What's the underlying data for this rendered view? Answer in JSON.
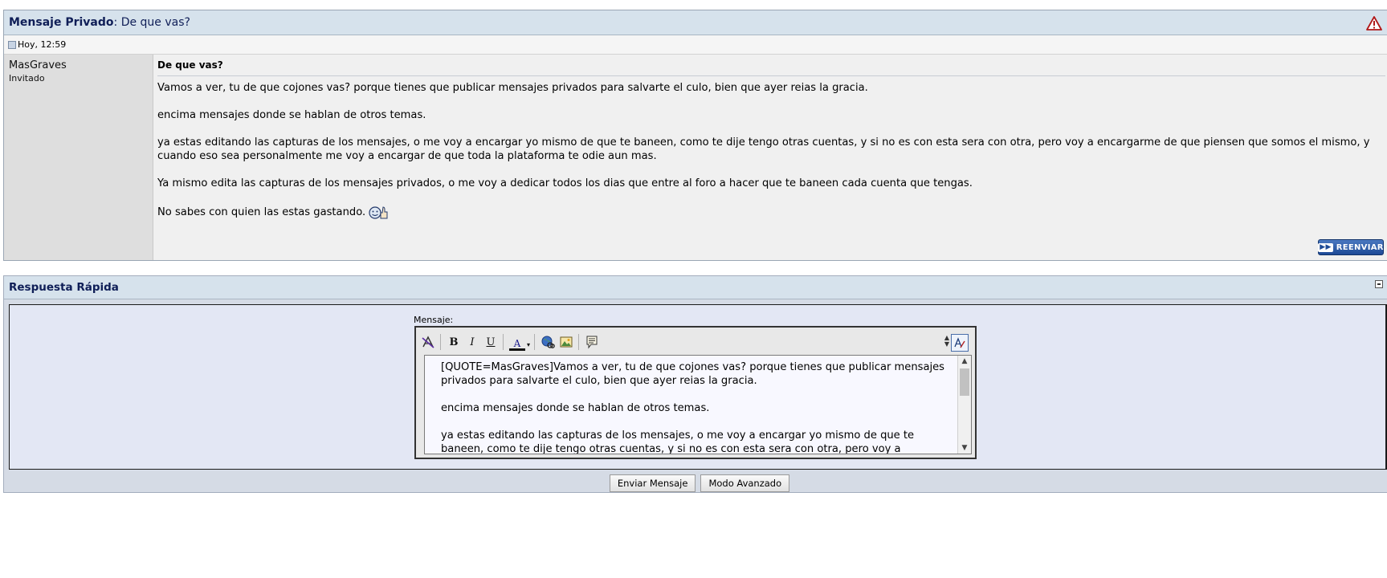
{
  "pm": {
    "header_label": "Mensaje Privado",
    "header_sep": ": ",
    "header_title": "De que vas?",
    "date": "Hoy, 12:59",
    "username": "MasGraves",
    "user_role": "Invitado",
    "subject": "De que vas?",
    "paragraphs": [
      "Vamos a ver, tu de que cojones vas? porque tienes que publicar mensajes privados para salvarte el culo, bien que ayer reias la gracia.",
      "encima mensajes donde se hablan de otros temas.",
      "ya estas editando las capturas de los mensajes, o me voy a encargar yo mismo de que te baneen, como te dije tengo otras cuentas, y si no es con esta sera con otra, pero voy a encargarme de que piensen que somos el mismo, y cuando eso sea personalmente me voy a encargar de que toda la plataforma te odie aun mas.",
      "Ya mismo edita las capturas de los mensajes privados, o me voy a dedicar todos los dias que entre al foro a hacer que te baneen cada cuenta que tengas.",
      "No sabes con quien las estas gastando."
    ],
    "forward_label": "REENVIAR",
    "forward_arrow": "▶▶"
  },
  "quick_reply": {
    "title": "Respuesta Rápida",
    "editor_label": "Mensaje:",
    "toolbar": {
      "bold": "B",
      "italic": "I",
      "underline": "U",
      "color": "A",
      "color_dropdown": "▾",
      "resize": "▴\n▾"
    },
    "textarea_lines": [
      "[QUOTE=MasGraves]Vamos a ver, tu de que cojones vas? porque tienes que publicar mensajes privados para salvarte el culo, bien que ayer reias la gracia.",
      "encima mensajes donde se hablan de otros temas.",
      "ya estas editando las capturas de los mensajes, o me voy a encargar yo mismo de que te baneen, como te dije tengo otras cuentas, y si no es con esta sera con otra, pero voy a"
    ],
    "send_label": "Enviar Mensaje",
    "advanced_label": "Modo Avanzado"
  }
}
